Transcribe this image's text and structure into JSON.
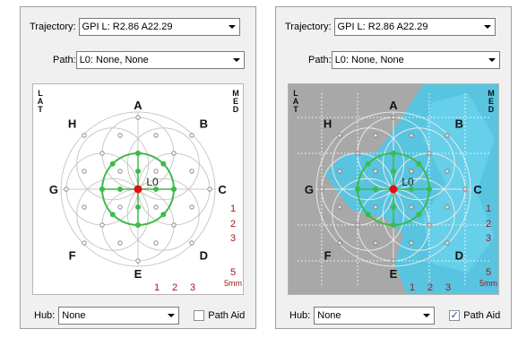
{
  "panels": [
    {
      "id": "left",
      "trajectory_label": "Trajectory:",
      "trajectory_value": "GPI L: R2.86  A22.29",
      "path_label": "Path:",
      "path_value": "L0: None, None",
      "hub_label": "Hub:",
      "hub_value": "None",
      "path_aid_label": "Path Aid",
      "path_aid_checked": false,
      "has_overlay": false
    },
    {
      "id": "right",
      "trajectory_label": "Trajectory:",
      "trajectory_value": "GPI L: R2.86  A22.29",
      "path_label": "Path:",
      "path_value": "L0: None, None",
      "hub_label": "Hub:",
      "hub_value": "None",
      "path_aid_label": "Path Aid",
      "path_aid_checked": true,
      "has_overlay": true
    }
  ],
  "plot": {
    "left_side_label": [
      "L",
      "A",
      "T"
    ],
    "right_side_label": [
      "M",
      "E",
      "D"
    ],
    "compass": [
      "A",
      "B",
      "C",
      "D",
      "E",
      "F",
      "G",
      "H"
    ],
    "center_label": "L0",
    "scale_labels_right": [
      "1",
      "2",
      "3",
      "5",
      "5mm"
    ],
    "scale_labels_bottom": [
      "1",
      "2",
      "3"
    ],
    "colors": {
      "ring_green": "#3dbb4a",
      "center_red": "#e01010",
      "scale_red": "#a01818",
      "overlay_blue": "#4fc6e6",
      "overlay_grey": "#a8a8a8"
    }
  }
}
